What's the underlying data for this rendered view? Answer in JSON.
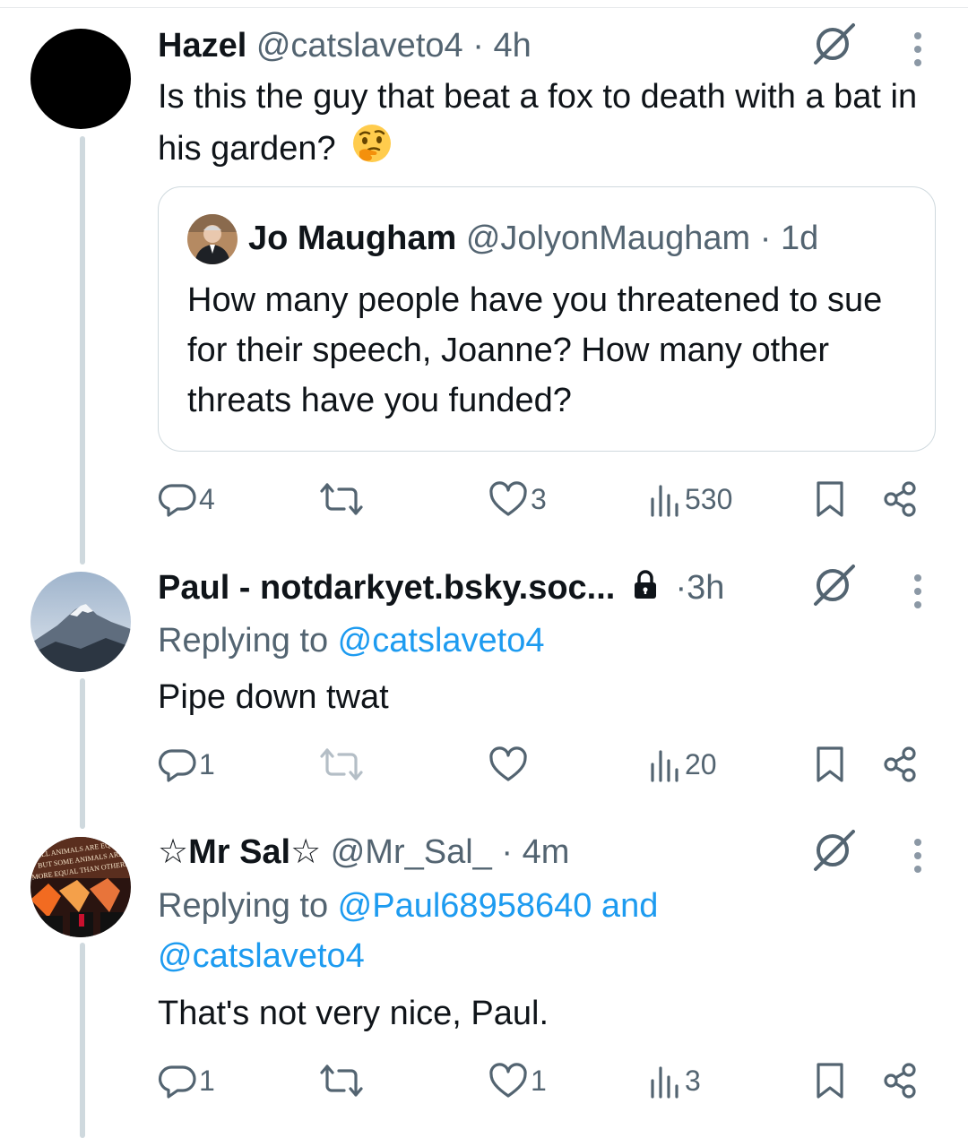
{
  "posts": [
    {
      "name": "Hazel",
      "handle": "@catslaveto4",
      "sep": "·",
      "time": "4h",
      "text": "Is this the guy that beat a fox to death with a bat in his garden?",
      "emoji": "thinking-face",
      "quote": {
        "name": "Jo Maugham",
        "handle": "@JolyonMaugham",
        "sep": "·",
        "time": "1d",
        "text": "How many people have you threatened to sue for their speech, Joanne?  How many other threats have you funded?"
      },
      "stats": {
        "replies": "4",
        "reposts": "",
        "likes": "3",
        "views": "530"
      }
    },
    {
      "name": "Paul - notdarkyet.bsky.soc...",
      "protected_icon": "lock-icon",
      "sep": "·",
      "time": "3h",
      "replying_prefix": "Replying to ",
      "replying_to": "@catslaveto4",
      "text": "Pipe down twat",
      "stats": {
        "replies": "1",
        "reposts": "",
        "likes": "",
        "views": "20"
      }
    },
    {
      "name": "☆Mr Sal☆",
      "handle": "@Mr_Sal_",
      "sep": "·",
      "time": "4m",
      "replying_prefix": "Replying to ",
      "replying_to_line1": "@Paul68958640 and",
      "replying_to_line2": "@catslaveto4",
      "text": "That's not very nice, Paul.",
      "avatar_text": [
        "ALL ANIMALS ARE EQUAL",
        "BUT SOME ANIMALS ARE",
        "MORE EQUAL THAN OTHERS"
      ],
      "stats": {
        "replies": "1",
        "reposts": "",
        "likes": "1",
        "views": "3"
      }
    }
  ],
  "colors": {
    "text": "#0f1419",
    "secondary": "#536471",
    "link": "#1d9bf0",
    "thread_line": "#cfd9de",
    "border": "#cfd9de"
  }
}
